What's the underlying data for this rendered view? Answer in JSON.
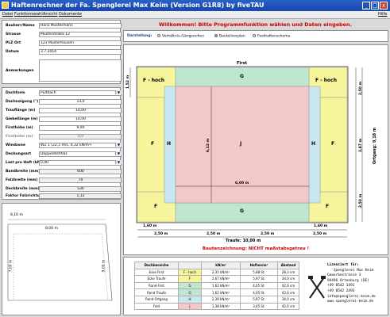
{
  "window": {
    "title": "Haftenrechner der Fa. Spenglerei Max Keim (Version G1R8) by fiveTAU",
    "min": "_",
    "max": "□",
    "close": "x"
  },
  "menu": {
    "items": [
      "Datei",
      "Funktionswahl",
      "Ansicht",
      "Dokumente"
    ],
    "help": "Hilfe"
  },
  "form": {
    "bauherr_label": "Bauherr/Name",
    "bauherr": "Hans Mustermann",
    "strasse_label": "Strasse",
    "strasse": "Musterstraße 12",
    "plz_label": "PLZ Ort",
    "plz": "123 Musterhausen",
    "datum_label": "Datum",
    "datum": "3.7.2014",
    "anm_label": "Anmerkungen"
  },
  "params": {
    "dachform_label": "Dachform",
    "dachform": "Pultdach",
    "dachneigung_label": "Dachneigung (°)",
    "dachneigung": "13,0",
    "traufe_label": "Trauflänge (m)",
    "traufe": "10,00",
    "giebel_label": "Giebellänge (m)",
    "giebel": "10,00",
    "first_label": "Firsthöhe (m)",
    "first": "9,00",
    "fh_label": "Firsthöhe (m)",
    "fh": "0,0",
    "windzone_label": "Windzone",
    "windzone": "WZ 1 (22,5 m/s, 0,32 kN/m²)",
    "deckung_label": "Deckungsart",
    "deckung": "Doppelstehfalz",
    "last_label": "Last pro Haft (kN)",
    "last": "0,40",
    "bandbreite_label": "Bandbreite (mm)",
    "bandbreite": "600",
    "falz_label": "Falzbreite (mm)",
    "falz": "70",
    "deckbreite_label": "Deckbreite (mm)",
    "deckbreite": "530",
    "faktor_label": "Faktor Falzrichtung",
    "faktor": "1,12"
  },
  "small_diagram": {
    "width": "8,16 m",
    "inner": "8,00 m",
    "side_left": "7,00 m",
    "side_right": "9,00 m"
  },
  "header_message": "Willkommen! Bitte Programmfunktion wählen und Daten eingeben.",
  "view": {
    "label": "Darstellung:",
    "options": [
      "Verhältnis-/Längsreihen",
      "Bauteilverplan",
      "Festhaftenschema"
    ],
    "selected_index": 1
  },
  "plan": {
    "first": "First",
    "traufe_label": "Traufe: 10,00 m",
    "f_hoch_left": "F - hoch",
    "f_hoch_right": "F - hoch",
    "g_top": "G",
    "g_bottom": "G",
    "j": "J",
    "f_left": "F",
    "f_right": "F",
    "f_bottom_left": "F",
    "f_bottom_right": "F",
    "h_left": "H",
    "h_right": "H",
    "dim_top_left": "1,52 m",
    "dim_side_right": "2,50 m",
    "dim_center_v": "6,13 m",
    "dim_center_h": "6,00 m",
    "dim_right_mid": "3,87 m",
    "dim_right_low": "2,50 m",
    "dim_ortgang": "Ortgang: 9,18 m",
    "dim_bottom_left": "1,60 m",
    "dim_bottom_right": "1,60 m",
    "dim_b1": "2,50 m",
    "dim_b2": "2,50 m",
    "dim_b3": "2,50 m",
    "dim_b4": "2,50 m"
  },
  "warning": "Bautenzeichnung: NICHT maßstabsgetreu !",
  "table": {
    "headers": [
      "Dachbereiche",
      "",
      "kN/m²",
      "Haften/m²",
      "Abstand"
    ],
    "rows": [
      [
        "Ecke First",
        "F - hoch",
        "2,35 kN/m²",
        "5,88 St.",
        "28,3 cm"
      ],
      [
        "Ecke Traufe",
        "F",
        "2,67 kN/m²",
        "5,97 St.",
        "34,0 cm"
      ],
      [
        "Rand First",
        "G",
        "1,62 kN/m²",
        "4,05 St.",
        "42,6 cm"
      ],
      [
        "Rand Traufe",
        "G",
        "1,62 kN/m²",
        "4,05 St.",
        "42,6 cm"
      ],
      [
        "Rand Ortgang",
        "H",
        "2,39 kN/m²",
        "5,97 St.",
        "34,0 cm"
      ],
      [
        "Feld",
        "J",
        "1,38 kN/m²",
        "3,45 St.",
        "42,6 cm"
      ]
    ],
    "row_colors": [
      "#f6f59b",
      "#f6f59b",
      "#bfe6cf",
      "#bfe6cf",
      "#c9e7f1",
      "#f3c8c8"
    ]
  },
  "company": {
    "title": "Lizenziert für:",
    "lines": [
      "Spenglerei Max Keim",
      "Gewerbestrasse 3",
      "94496 Ortenburg (DE)",
      "+49 8542 1491",
      "+49 8542 2493",
      "info@spenglerei-keim.de",
      "www.spenglerei-keim.de"
    ]
  },
  "colors": {
    "yellow": "#f6f59b",
    "green": "#bfe6cf",
    "blue": "#c9e7f1",
    "pink": "#f3c8c8",
    "red": "#d00000"
  }
}
